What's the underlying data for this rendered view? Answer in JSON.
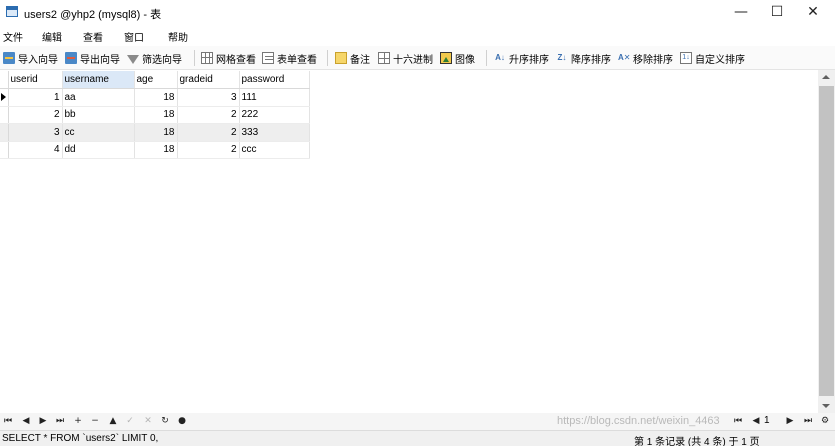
{
  "window": {
    "title": "users2 @yhp2 (mysql8) - 表",
    "minimize_glyph": "—",
    "maximize_glyph": "☐",
    "close_glyph": "✕"
  },
  "menu": [
    "文件",
    "编辑",
    "查看",
    "窗口",
    "帮助"
  ],
  "toolbar": {
    "import": "导入向导",
    "export": "导出向导",
    "filter": "筛选向导",
    "grid_view": "网格查看",
    "form_view": "表单查看",
    "memo": "备注",
    "hex": "十六进制",
    "image": "图像",
    "sort_asc": "升序排序",
    "sort_desc": "降序排序",
    "remove_sort": "移除排序",
    "custom_sort": "自定义排序"
  },
  "table": {
    "columns": [
      "userid",
      "username",
      "age",
      "gradeid",
      "password"
    ],
    "selected_column": "username",
    "current_row": 0,
    "rows": [
      [
        "1",
        "aa",
        "18",
        "3",
        "111"
      ],
      [
        "2",
        "bb",
        "18",
        "2",
        "222"
      ],
      [
        "3",
        "cc",
        "18",
        "2",
        "333"
      ],
      [
        "4",
        "dd",
        "18",
        "2",
        "ccc"
      ]
    ]
  },
  "navigation": {
    "first": "⏮",
    "prev": "◀",
    "next": "▶",
    "last": "⏭",
    "add": "+",
    "delete": "−",
    "up": "▲",
    "apply": "✓",
    "discard": "✕",
    "refresh": "↻",
    "stop": "●",
    "page_first": "⏮",
    "page_prev": "◀",
    "page_number": "1",
    "page_next": "▶",
    "page_last": "⏭",
    "settings": "⚙",
    "watermark": "https://blog.csdn.net/weixin_4463"
  },
  "status": {
    "sql": "SELECT * FROM `users2` LIMIT 0,",
    "records": "第 1 条记录 (共 4 条) 于 1 页"
  },
  "colors": {
    "selected_header": "#dbe8f7",
    "alt_row": "#eeeeee",
    "scroll_thumb": "#c2c2c2"
  }
}
